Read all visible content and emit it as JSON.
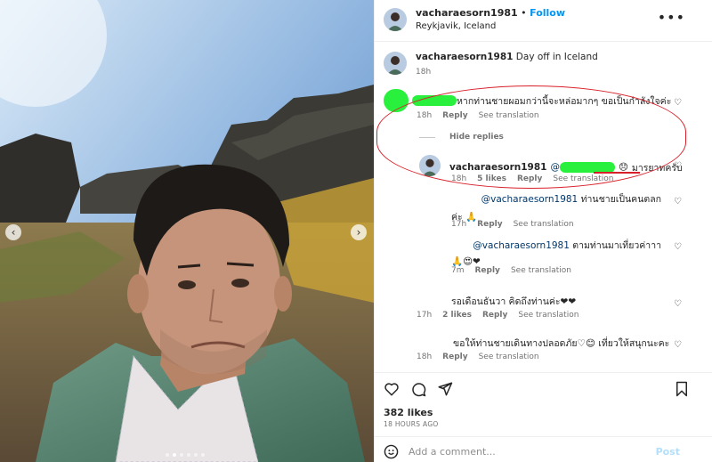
{
  "post": {
    "username": "vacharaesorn1981",
    "follow_label": "Follow",
    "location": "Reykjavik, Iceland",
    "more_icon": "more-horizontal-icon",
    "caption_username": "vacharaesorn1981",
    "caption_text": "Day off in Iceland",
    "caption_time": "18h"
  },
  "photo": {
    "prev_icon": "‹",
    "next_icon": "›",
    "dots_total": 6,
    "active_dot": 1
  },
  "comments": [
    {
      "text": "หากท่านชายผอมกว่านี้จะหล่อมากๆ ขอเป็นกำลังใจค่ะ",
      "time": "18h",
      "reply": "Reply",
      "see_translation": "See translation",
      "hide_replies": "Hide replies"
    },
    {
      "username": "vacharaesorn1981",
      "mention": "@",
      "text": "มารยาทครับ",
      "time": "18h",
      "likes": "5 likes",
      "reply": "Reply",
      "see_translation": "See translation"
    },
    {
      "mention": "@vacharaesorn1981",
      "text_line1": "ท่านชายเป็นคนตลก",
      "text_line2": "ค่ะ 🙏",
      "time": "17h",
      "reply": "Reply",
      "see_translation": "See translation"
    },
    {
      "mention": "@vacharaesorn1981",
      "text_line1": "ตามท่านมาเที่ยวค่าาา",
      "text_line2": "🙏😍❤",
      "time": "7m",
      "reply": "Reply",
      "see_translation": "See translation"
    },
    {
      "text": "รอเดือนธันวา คิดถึงท่านค่ะ❤❤",
      "time": "17h",
      "likes": "2 likes",
      "reply": "Reply",
      "see_translation": "See translation"
    },
    {
      "text": "ขอให้ท่านชายเดินทางปลอดภัย♡😊 เที่ยวให้สนุกนะคะ",
      "time": "18h",
      "reply": "Reply",
      "see_translation": "See translation"
    }
  ],
  "footer": {
    "likes": "382 likes",
    "time_ago": "18 HOURS AGO",
    "add_comment_placeholder": "Add a comment...",
    "post_label": "Post"
  },
  "colors": {
    "accent": "#0095f6",
    "highlight_red": "#d8202a",
    "redaction_green": "#28f03c"
  }
}
